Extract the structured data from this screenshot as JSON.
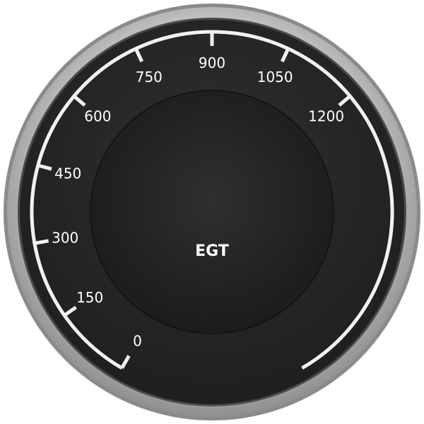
{
  "gauge": {
    "label": "EGT",
    "scale_min": 0,
    "scale_max": 1800,
    "major_step": 150,
    "tick_labels": [
      "0",
      "150",
      "300",
      "450",
      "600",
      "750",
      "900",
      "1050",
      "1200"
    ],
    "colors": {
      "face": "#2a2a2a",
      "inner_face": "#262626",
      "scale": "#f2f2f2",
      "bezel": "#b9b9b9"
    }
  }
}
